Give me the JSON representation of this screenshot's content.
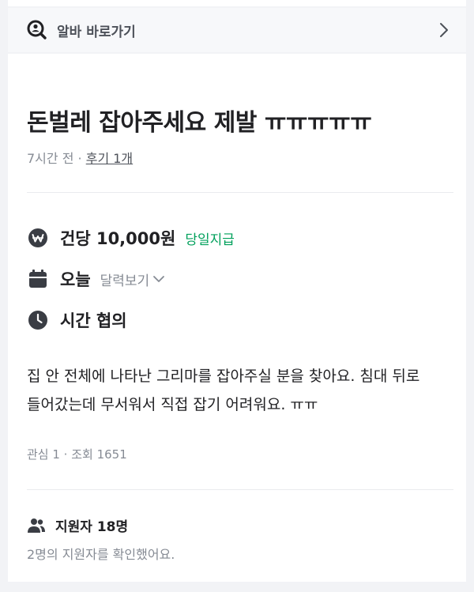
{
  "shortcut": {
    "label": "알바 바로가기",
    "icon": "search-person-icon",
    "chevron": "chevron-right-icon"
  },
  "post": {
    "title": "돈벌레 잡아주세요 제발 ㅠㅠㅠㅠㅠ",
    "time_ago": "7시간 전",
    "separator": "·",
    "review_link": "후기 1개"
  },
  "details": {
    "pay": {
      "icon": "won-icon",
      "text": "건당 10,000원",
      "badge": "당일지급"
    },
    "date": {
      "icon": "calendar-icon",
      "text": "오늘",
      "calendar_link": "달력보기"
    },
    "time": {
      "icon": "clock-icon",
      "text": "시간 협의"
    }
  },
  "description": "집 안 전체에 나타난 그리마를 잡아주실 분을 찾아요. 침대 뒤로 들어갔는데 무서워서 직접 잡기 어려워요. ㅠㅠ",
  "stats": {
    "text": "관심 1 · 조회 1651"
  },
  "applicants": {
    "icon": "people-icon",
    "label": "지원자 18명",
    "sub": "2명의 지원자를 확인했어요."
  },
  "colors": {
    "accent_green": "#00a05b",
    "icon_dark": "#3a3d44",
    "muted": "#868b94"
  }
}
